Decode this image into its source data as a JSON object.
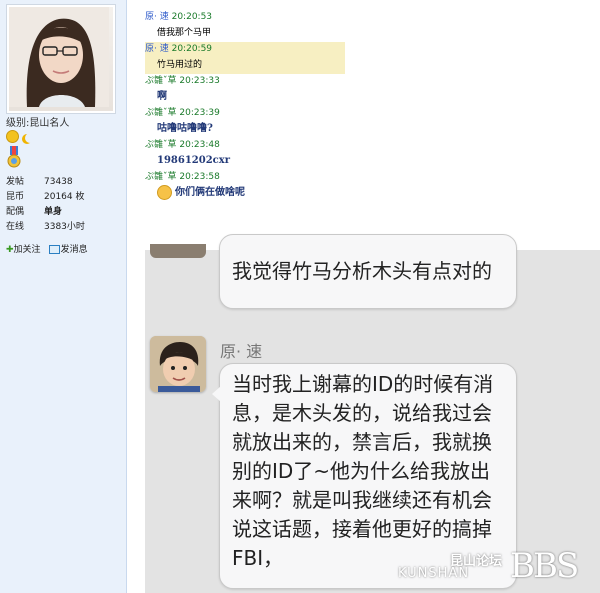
{
  "profile": {
    "rank_label": "级别:",
    "rank_value": "昆山名人",
    "stats": [
      {
        "label": "发帖",
        "value": "73438"
      },
      {
        "label": "昆币",
        "value": "20164 枚"
      },
      {
        "label": "配偶",
        "value": "单身"
      },
      {
        "label": "在线",
        "value": "3383小时"
      }
    ],
    "follow_label": "加关注",
    "message_label": "发消息"
  },
  "qq_log": [
    {
      "sender": "原· 速",
      "time": "20:20:53",
      "text": "借我那个马甲",
      "style": "normal"
    },
    {
      "sender": "原· 速",
      "time": "20:20:59",
      "text": "竹马用过的",
      "style": "highlight"
    },
    {
      "sender": "ぷ雛ˇ草",
      "time": "20:23:33",
      "text": "啊",
      "style": "big"
    },
    {
      "sender": "ぷ雛ˇ草",
      "time": "20:23:39",
      "text": "咕噜咕噜噜?",
      "style": "big"
    },
    {
      "sender": "ぷ雛ˇ草",
      "time": "20:23:48",
      "text": "19861202cxr",
      "style": "big"
    },
    {
      "sender": "ぷ雛ˇ草",
      "time": "20:23:58",
      "text": "你们俩在做啥呢",
      "style": "big-emoji"
    }
  ],
  "phone_chat": {
    "bubble1_text": "我觉得竹马分析木头有点对的",
    "sender": "原· 速",
    "bubble2_text": "当时我上谢幕的ID的时候有消息，是木头发的，说给我过会就放出来的，禁言后，我就换别的ID了~他为什么给我放出来啊？就是叫我继续还有机会说这话题，接着他更好的搞掉FBI，"
  },
  "watermark": {
    "cn": "昆山论坛",
    "en": "KUNSHAN",
    "bbs": "BBS"
  },
  "colors": {
    "sidebar_bg": "#e9f1fb",
    "qq_time_green": "#1a7a2a",
    "qq_highlight": "#f7efc2",
    "phone_bg": "#e3e3e3"
  }
}
